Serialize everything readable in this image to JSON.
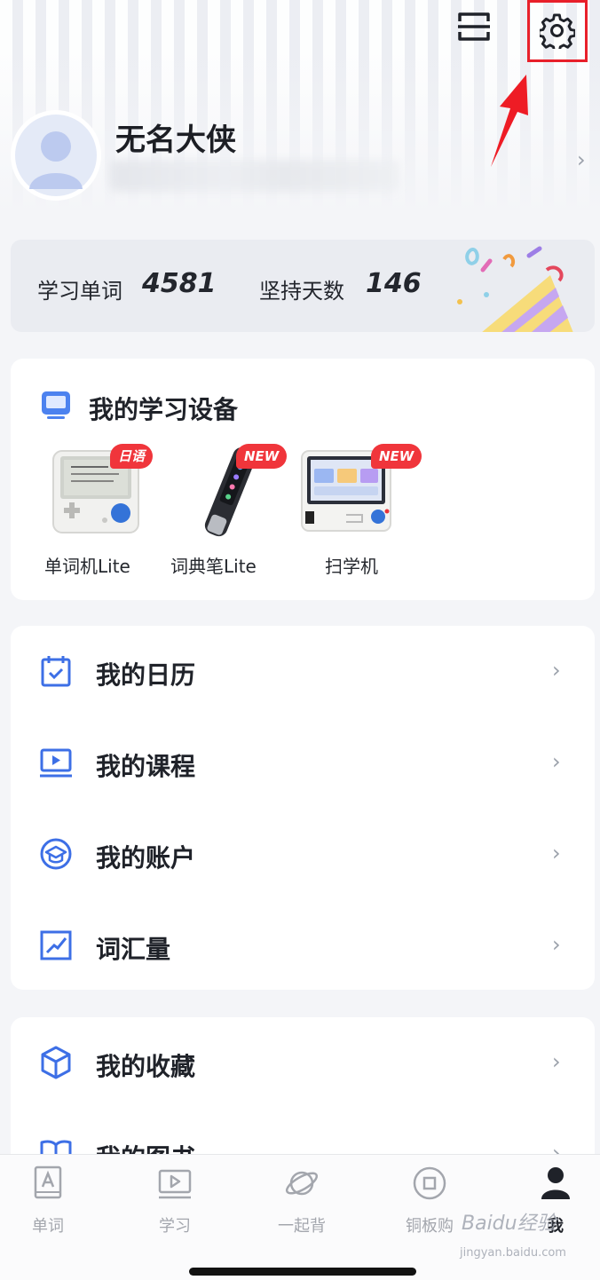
{
  "header": {
    "scan_icon": "scan-icon",
    "settings_icon": "gear-icon",
    "highlight_color": "#e8202a"
  },
  "profile": {
    "name": "无名大侠"
  },
  "stats": {
    "words_label": "学习单词",
    "words_value": "4581",
    "days_label": "坚持天数",
    "days_value": "146"
  },
  "devices": {
    "title": "我的学习设备",
    "items": [
      {
        "name": "单词机Lite",
        "badge": "日语"
      },
      {
        "name": "词典笔Lite",
        "badge": "NEW"
      },
      {
        "name": "扫学机",
        "badge": "NEW"
      }
    ]
  },
  "menu": {
    "group1": [
      {
        "label": "我的日历",
        "icon": "calendar-icon"
      },
      {
        "label": "我的课程",
        "icon": "course-icon"
      },
      {
        "label": "我的账户",
        "icon": "account-icon"
      },
      {
        "label": "词汇量",
        "icon": "chart-icon"
      }
    ],
    "group2": [
      {
        "label": "我的收藏",
        "icon": "box-icon"
      },
      {
        "label": "我的图书",
        "icon": "book-icon"
      }
    ]
  },
  "tabs": [
    {
      "label": "单词",
      "icon": "word-icon"
    },
    {
      "label": "学习",
      "icon": "play-icon"
    },
    {
      "label": "一起背",
      "icon": "planet-icon"
    },
    {
      "label": "铜板购",
      "icon": "shop-icon"
    },
    {
      "label": "我",
      "icon": "person-icon",
      "active": true
    }
  ],
  "watermark": {
    "text": "Baidu经验",
    "sub": "jingyan.baidu.com"
  },
  "colors": {
    "accent": "#3d6fe6",
    "badge_red": "#f0353b"
  }
}
